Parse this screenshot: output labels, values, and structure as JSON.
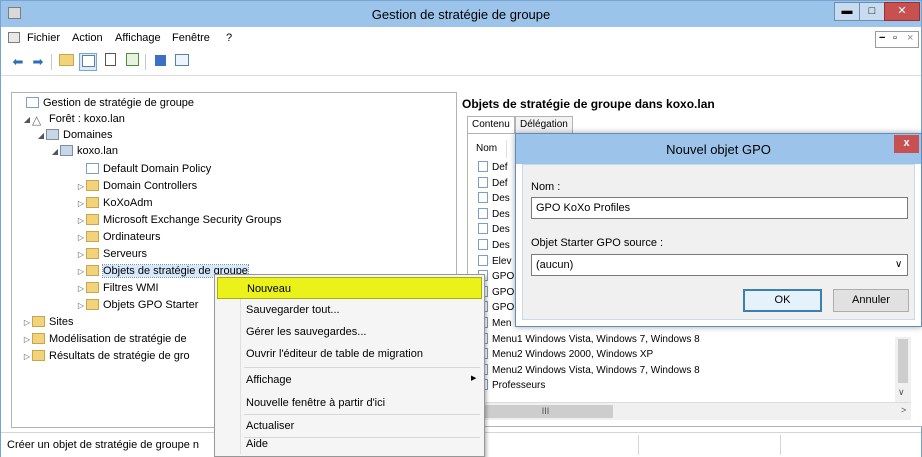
{
  "window": {
    "title": "Gestion de stratégie de groupe",
    "controls": {
      "minimize": "▬",
      "maximize": "□",
      "close": "✕"
    },
    "inner_controls": {
      "minimize": "−",
      "restore": "▫",
      "close": "×"
    }
  },
  "menubar": {
    "items": [
      "Fichier",
      "Action",
      "Affichage",
      "Fenêtre",
      "?"
    ]
  },
  "toolbar": {
    "icons": [
      "back-arrow-icon",
      "forward-arrow-icon",
      "up-folder-icon",
      "show-tree-icon",
      "properties-icon",
      "refresh-icon",
      "help-icon",
      "console-icon"
    ]
  },
  "tree": {
    "items": [
      {
        "label": "Gestion de stratégie de groupe",
        "icon": "console"
      },
      {
        "label": "Forêt : koxo.lan",
        "icon": "forest"
      },
      {
        "label": "Domaines",
        "icon": "domain"
      },
      {
        "label": "koxo.lan",
        "icon": "domain"
      },
      {
        "label": "Default Domain Policy",
        "icon": "gpo"
      },
      {
        "label": "Domain Controllers",
        "icon": "folder"
      },
      {
        "label": "KoXoAdm",
        "icon": "folder"
      },
      {
        "label": "Microsoft Exchange Security Groups",
        "icon": "folder"
      },
      {
        "label": "Ordinateurs",
        "icon": "folder"
      },
      {
        "label": "Serveurs",
        "icon": "folder"
      },
      {
        "label": "Objets de stratégie de groupe",
        "icon": "folder"
      },
      {
        "label": "Filtres WMI",
        "icon": "folder"
      },
      {
        "label": "Objets GPO Starter",
        "icon": "folder"
      },
      {
        "label": "Sites",
        "icon": "folder"
      },
      {
        "label": "Modélisation de stratégie de",
        "icon": "folder"
      },
      {
        "label": "Résultats de stratégie de gro",
        "icon": "folder"
      }
    ]
  },
  "right_pane": {
    "title": "Objets de stratégie de groupe dans koxo.lan",
    "tabs": [
      "Contenu",
      "Délégation"
    ],
    "column_header": "Nom",
    "rows": [
      "Def",
      "Def",
      "Des",
      "Des",
      "Des",
      "Des",
      "Elev",
      "GPO",
      "GPO",
      "GPO",
      "Men",
      "Menu1 Windows Vista, Windows 7, Windows 8",
      "Menu2 Windows 2000, Windows XP",
      "Menu2 Windows Vista, Windows 7, Windows 8",
      "Professeurs"
    ],
    "hscroll_thumb": "III"
  },
  "statusbar": {
    "text": "Créer un objet de stratégie de groupe n"
  },
  "context_menu": {
    "items": [
      "Nouveau",
      "Sauvegarder tout...",
      "Gérer les sauvegardes...",
      "Ouvrir l'éditeur de table de migration",
      "Affichage",
      "Nouvelle fenêtre à partir d'ici",
      "Actualiser",
      "Aide"
    ],
    "submenu_arrow": "▶"
  },
  "dialog": {
    "title": "Nouvel objet GPO",
    "close": "x",
    "name_label": "Nom :",
    "name_value": "GPO KoXo Profiles",
    "starter_label": "Objet Starter GPO source :",
    "starter_value": "(aucun)",
    "dropdown_arrow": "∨",
    "ok": "OK",
    "cancel": "Annuler"
  },
  "colors": {
    "titlebar": "#9cc4ea",
    "close": "#c75050",
    "highlight": "#eaf21a",
    "selection": "#d7e8fb"
  }
}
